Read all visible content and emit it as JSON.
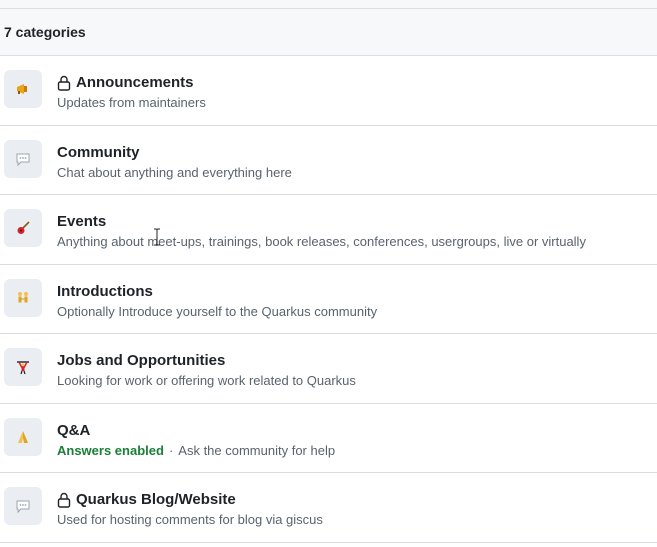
{
  "header": {
    "title": "7 categories"
  },
  "categories": [
    {
      "icon": "megaphone-icon",
      "locked": true,
      "title": "Announcements",
      "description": "Updates from maintainers"
    },
    {
      "icon": "speech-bubble-icon",
      "locked": false,
      "title": "Community",
      "description": "Chat about anything and everything here"
    },
    {
      "icon": "guitar-icon",
      "locked": false,
      "title": "Events",
      "description": "Anything about meet-ups, trainings, book releases, conferences, usergroups, live or virtually"
    },
    {
      "icon": "people-holding-hands-icon",
      "locked": false,
      "title": "Introductions",
      "description": "Optionally Introduce yourself to the Quarkus community"
    },
    {
      "icon": "person-lifting-weights-icon",
      "locked": false,
      "title": "Jobs and Opportunities",
      "description": "Looking for work or offering work related to Quarkus"
    },
    {
      "icon": "folded-hands-icon",
      "locked": false,
      "title": "Q&A",
      "badge": "Answers enabled",
      "separator": "·",
      "description": "Ask the community for help"
    },
    {
      "icon": "speech-bubble-icon",
      "locked": true,
      "title": "Quarkus Blog/Website",
      "description": "Used for hosting comments for blog via giscus"
    }
  ],
  "colors": {
    "header_bg": "#f6f8fa",
    "border": "#d8dee4",
    "title_text": "#1f2328",
    "muted_text": "#59636e",
    "answers_green": "#1a7f37",
    "icon_bg": "#eaeef2"
  }
}
